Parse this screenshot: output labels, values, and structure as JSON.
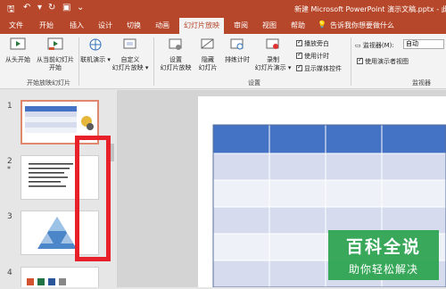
{
  "window": {
    "title": "新建 Microsoft PowerPoint 演示文稿.pptx - 此电脑"
  },
  "menu_tabs": [
    "文件",
    "开始",
    "插入",
    "设计",
    "切换",
    "动画",
    "幻灯片放映",
    "审阅",
    "视图",
    "帮助"
  ],
  "active_tab": "幻灯片放映",
  "tell_me": "告诉我你想要做什么",
  "ribbon": {
    "from_beginning": "从头开始",
    "from_current_1": "从当前幻灯片",
    "from_current_2": "开始",
    "online_present": "联机演示",
    "custom_show_1": "自定义",
    "custom_show_2": "幻灯片放映",
    "group_start": "开始放映幻灯片",
    "setup_show_1": "设置",
    "setup_show_2": "幻灯片放映",
    "hide_slide_1": "隐藏",
    "hide_slide_2": "幻灯片",
    "rehearse": "排练计时",
    "record_1": "录制",
    "record_2": "幻灯片演示",
    "cb_narration": "播放旁白",
    "cb_timings": "使用计时",
    "cb_media": "显示媒体控件",
    "group_setup": "设置",
    "monitor_label": "监视器(M):",
    "monitor_value": "自动",
    "cb_presenter": "使用演示者视图",
    "group_monitor": "监视器"
  },
  "slides": [
    {
      "num": "1"
    },
    {
      "num": "2"
    },
    {
      "num": "3"
    },
    {
      "num": "4"
    }
  ],
  "slide2_star": "*",
  "watermark": {
    "line1": "百科全说",
    "line2": "助你轻松解决"
  },
  "colors": {
    "brand": "#b7472a",
    "table_header": "#4472c4",
    "table_band": "#d6dcee",
    "annotation": "#e8202a",
    "watermark": "#29a24c"
  }
}
